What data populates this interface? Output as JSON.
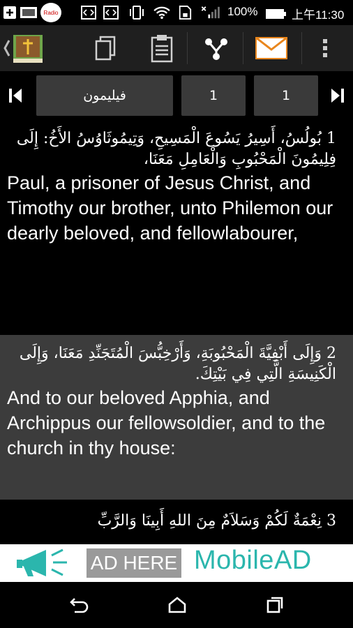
{
  "status_bar": {
    "battery": "100%",
    "time": "上午11:30",
    "radio_label": "Radio"
  },
  "nav": {
    "book": "فيليمون",
    "chapter": "1",
    "verse": "1"
  },
  "verses": [
    {
      "arabic": "1  بُولُسُ، أَسِيرُ يَسُوعَ الْمَسِيحِ، وَتِيمُوثَاوُسُ الأَخُ: إِلَى فِلِيمُونَ الْمَحْبُوبِ وَالْعَامِلِ مَعَنَا،",
      "english": "Paul, a prisoner of Jesus Christ, and Timothy our brother, unto Philemon our dearly beloved, and fellowlabourer,"
    },
    {
      "arabic": "2  وَإِلَى أَبْفِيَّةَ الْمَحْبُوبَةِ، وَأَرْخِبُّسَ الْمُتَجَنِّدِ مَعَنَا، وَإِلَى الْكَنِيسَةِ الَّتِي فِي بَيْتِكَ.",
      "english": "And to our beloved Apphia, and Archippus our fellowsoldier, and to the church in thy house:"
    },
    {
      "arabic": "3  نِعْمَةٌ لَكُمْ وَسَلاَمٌ مِنَ اللهِ أَبِينَا وَالرَّبِّ",
      "english": ""
    }
  ],
  "ad": {
    "left": "AD HERE",
    "right": "MobileAD"
  },
  "colors": {
    "accent_teal": "#2bb6ad",
    "mail_orange": "#e9861d",
    "row_alt": "#3c3c3c"
  },
  "icons": [
    "back-chevron-icon",
    "bible-app-icon",
    "copy-icon",
    "clipboard-icon",
    "share-icon",
    "mail-icon",
    "overflow-menu-icon",
    "first-page-icon",
    "last-page-icon",
    "back-nav-icon",
    "home-nav-icon",
    "recents-nav-icon"
  ]
}
